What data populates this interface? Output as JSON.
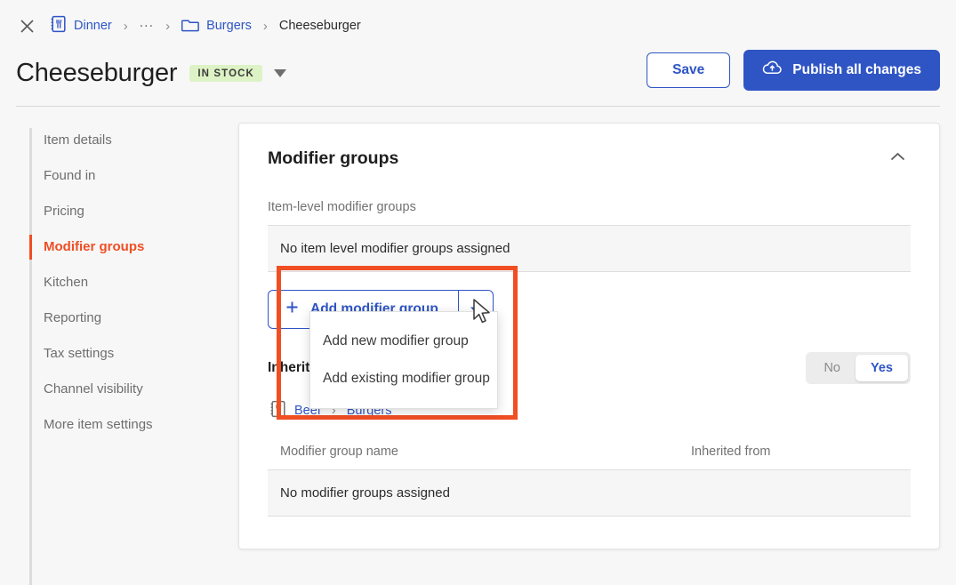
{
  "breadcrumb": {
    "close_icon": "close-x-icon",
    "items": [
      {
        "label": "Dinner",
        "icon": "menu-book-icon",
        "link": true
      },
      {
        "label": "...",
        "icon": "",
        "link": true
      },
      {
        "label": "Burgers",
        "icon": "folder-icon",
        "link": true
      },
      {
        "label": "Cheeseburger",
        "icon": "",
        "link": false
      }
    ],
    "separator": "›"
  },
  "header": {
    "title": "Cheeseburger",
    "status_badge": "IN STOCK",
    "status_badge_bg": "#ddf2c5",
    "status_caret_icon": "caret-down-icon",
    "save_label": "Save",
    "publish_label": "Publish all changes",
    "publish_icon": "cloud-upload-icon",
    "accent_blue": "#2f55c5"
  },
  "sidebar": {
    "items": [
      {
        "label": "Item details",
        "active": false
      },
      {
        "label": "Found in",
        "active": false
      },
      {
        "label": "Pricing",
        "active": false
      },
      {
        "label": "Modifier groups",
        "active": true
      },
      {
        "label": "Kitchen",
        "active": false
      },
      {
        "label": "Reporting",
        "active": false
      },
      {
        "label": "Tax settings",
        "active": false
      },
      {
        "label": "Channel visibility",
        "active": false
      },
      {
        "label": "More item settings",
        "active": false
      }
    ],
    "active_color": "#f04e23"
  },
  "card": {
    "title": "Modifier groups",
    "collapse_icon": "chevron-up-icon",
    "item_level_label": "Item-level modifier groups",
    "item_level_empty": "No item level modifier groups assigned",
    "add_button_label": "Add modifier group",
    "add_button_plus_icon": "plus-icon",
    "add_button_caret_icon": "caret-down-icon",
    "inherited_label": "Inherited modifier groups",
    "toggle": {
      "options": [
        "No",
        "Yes"
      ],
      "selected": "Yes"
    },
    "inherited_path": {
      "icon": "menu-book-icon",
      "parts": [
        "Beef",
        "Burgers"
      ],
      "separator": "›"
    },
    "table": {
      "columns": [
        "Modifier group name",
        "Inherited from"
      ],
      "empty_message": "No modifier groups assigned"
    }
  },
  "dropdown_menu": {
    "items": [
      "Add new modifier group",
      "Add existing modifier group"
    ]
  },
  "annotation": {
    "highlight_color": "#f04e23",
    "cursor_icon": "mouse-arrow-cursor"
  }
}
